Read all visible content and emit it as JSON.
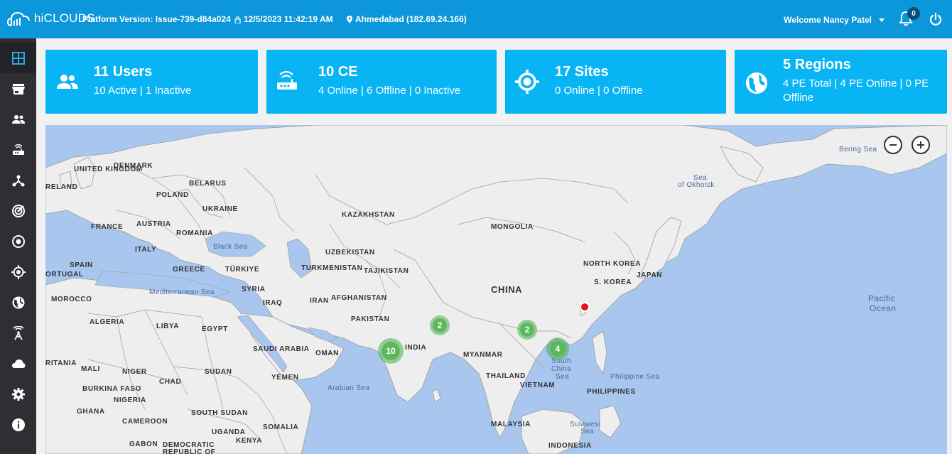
{
  "app": {
    "logo_text": "hiCLOUDS",
    "platform_version": "Platform Version: Issue-739-d84a024",
    "datetime": "12/5/2023 11:42:19 AM",
    "location": "Ahmedabad (182.69.24.166)",
    "welcome": "Welcome Nancy Patel",
    "notification_count": "0"
  },
  "sidebar": {
    "items": [
      {
        "name": "dashboard-icon",
        "active": true
      },
      {
        "name": "store-icon"
      },
      {
        "name": "users-icon"
      },
      {
        "name": "router-icon"
      },
      {
        "name": "network-icon"
      },
      {
        "name": "signal-icon"
      },
      {
        "name": "target-icon"
      },
      {
        "name": "crosshair-icon"
      },
      {
        "name": "globe-icon"
      },
      {
        "name": "antenna-icon"
      },
      {
        "name": "cloud-icon"
      },
      {
        "name": "settings-icon"
      },
      {
        "name": "info-icon"
      }
    ]
  },
  "cards": [
    {
      "title": "11 Users",
      "subtitle": "10 Active | 1 Inactive",
      "icon": "users-icon"
    },
    {
      "title": "10 CE",
      "subtitle": "4 Online | 6 Offline | 0 Inactive",
      "icon": "router-icon"
    },
    {
      "title": "17 Sites",
      "subtitle": "0 Online | 0 Offline",
      "icon": "crosshair-icon"
    },
    {
      "title": "5 Regions",
      "subtitle": "4 PE Total | 4 PE Online | 0 PE Offline",
      "icon": "globe-icon"
    }
  ],
  "map": {
    "clusters": [
      "2",
      "2",
      "4",
      "10"
    ],
    "labels": {
      "united_kingdom": "UNITED KINGDOM",
      "ireland": "RELAND",
      "denmark": "DENMARK",
      "belarus": "BELARUS",
      "poland": "POLAND",
      "ukraine": "UKRAINE",
      "france": "FRANCE",
      "austria": "AUSTRIA",
      "romania": "ROMANIA",
      "italy": "ITALY",
      "spain": "SPAIN",
      "portugal": "ORTUGAL",
      "greece": "GREECE",
      "turkiye": "TÜRKIYE",
      "black_sea": "Black Sea",
      "mediterranean": "Mediterranean Sea",
      "morocco": "MOROCCO",
      "algeria": "ALGERIA",
      "libya": "LIBYA",
      "egypt": "EGYPT",
      "syria": "SYRIA",
      "iraq": "IRAQ",
      "iran": "IRAN",
      "kazakhstan": "KAZAKHSTAN",
      "uzbekistan": "UZBEKISTAN",
      "turkmenistan": "TURKMENISTAN",
      "tajikistan": "TAJIKISTAN",
      "afghanistan": "AFGHANISTAN",
      "pakistan": "PAKISTAN",
      "india": "INDIA",
      "mongolia": "MONGOLIA",
      "china": "CHINA",
      "north_korea": "NORTH KOREA",
      "south_korea": "S. KOREA",
      "japan": "JAPAN",
      "myanmar": "MYANMAR",
      "thailand": "THAILAND",
      "vietnam": "VIETNAM",
      "philippines": "PHILIPPINES",
      "malaysia": "MALAYSIA",
      "indonesia": "INDONESIA",
      "saudi_arabia": "SAUDI ARABIA",
      "oman": "OMAN",
      "yemen": "YEMEN",
      "sudan": "SUDAN",
      "south_sudan": "SOUTH SUDAN",
      "chad": "CHAD",
      "niger": "NIGER",
      "mali": "MALI",
      "nigeria": "NIGERIA",
      "burkina_faso": "BURKINA FASO",
      "ghana": "GHANA",
      "cameroon": "CAMEROON",
      "gabon": "GABON",
      "dr_congo_1": "DEMOCRATIC",
      "dr_congo_2": "REPUBLIC OF",
      "uganda": "UGANDA",
      "kenya": "KENYA",
      "somalia": "SOMALIA",
      "mauritania": "RITANIA",
      "arabian_sea": "Arabian Sea",
      "south_china_sea_1": "South",
      "south_china_sea_2": "China",
      "south_china_sea_3": "Sea",
      "philippine_sea": "Philippine Sea",
      "sulawesi_1": "Sulawesi",
      "sulawesi_2": "Sea",
      "pacific_1": "Pacific",
      "pacific_2": "Ocean",
      "okhotsk_1": "Sea",
      "okhotsk_2": "of Okhotsk",
      "bering": "Bering Sea"
    }
  },
  "colors": {
    "topbar": "#0b97d9",
    "card": "#08b4f4",
    "sidebar": "#2f2f33",
    "ocean": "#a8c6ee",
    "land": "#eeeeee",
    "cluster": "#5cb85c",
    "pin": "#e0141c"
  }
}
